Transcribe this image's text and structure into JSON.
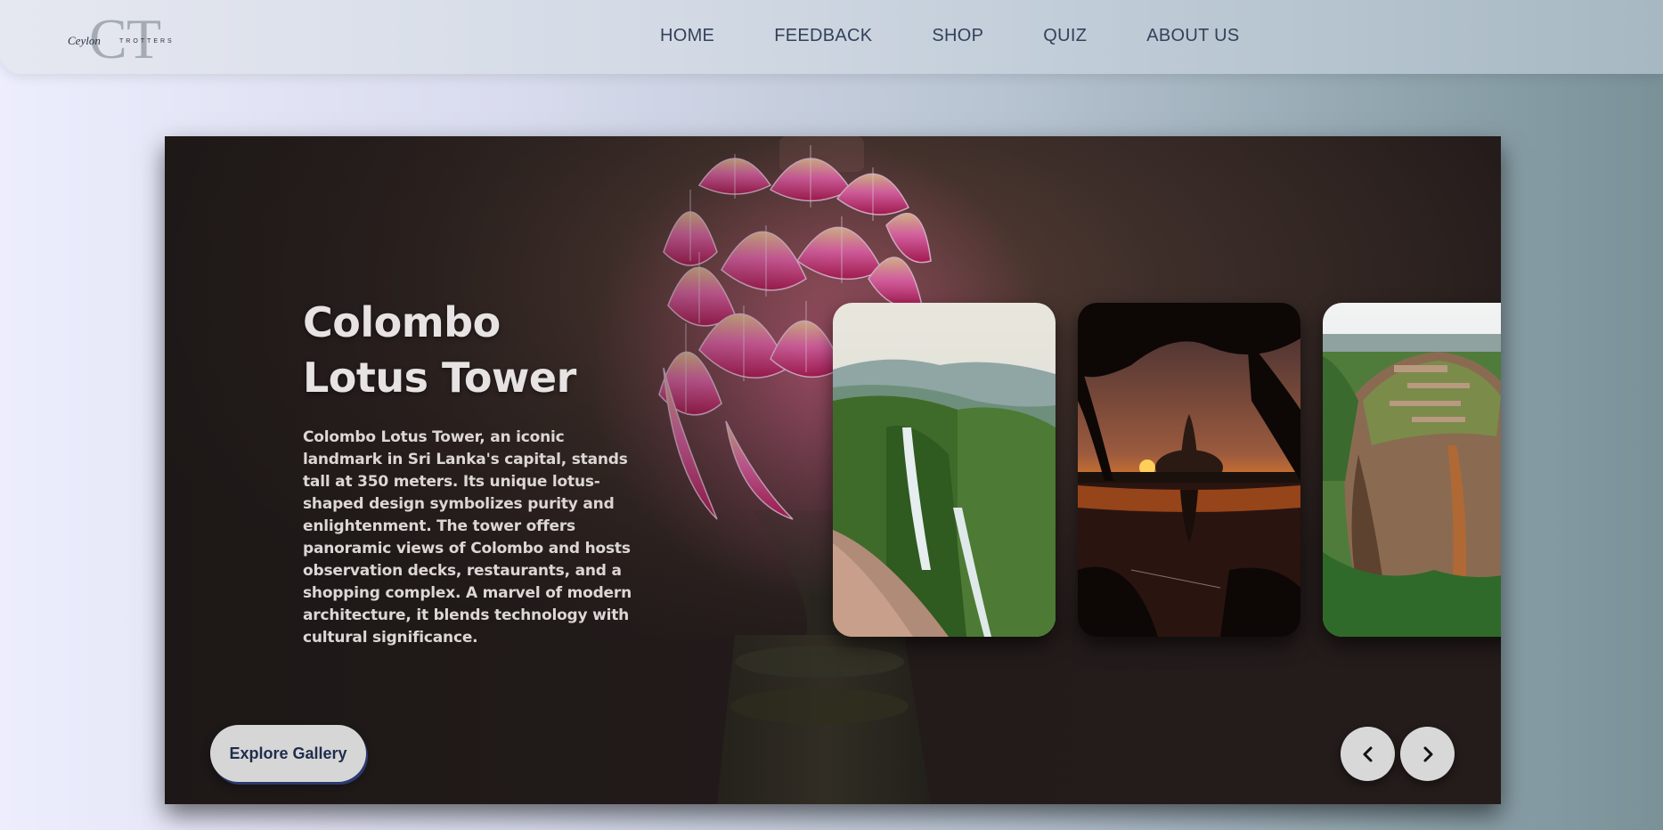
{
  "brand": {
    "logo_letters": "CT",
    "logo_script": "Ceylon",
    "logo_caps": "TROTTERS"
  },
  "nav": {
    "items": [
      {
        "label": "HOME"
      },
      {
        "label": "FEEDBACK"
      },
      {
        "label": "SHOP"
      },
      {
        "label": "QUIZ"
      },
      {
        "label": "ABOUT US"
      }
    ]
  },
  "hero": {
    "title": "Colombo Lotus Tower",
    "description": "Colombo Lotus Tower, an iconic landmark in Sri Lanka's capital, stands tall at 350 meters. Its unique lotus-shaped design symbolizes purity and enlightenment. The tower offers panoramic views of Colombo and hosts observation decks, restaurants, and a shopping complex. A marvel of modern architecture, it blends technology with cultural significance.",
    "explore_label": "Explore Gallery",
    "cards": [
      {
        "icon": "waterfall-image"
      },
      {
        "icon": "stupa-sunset-image"
      },
      {
        "icon": "sigiriya-rock-image"
      }
    ],
    "prev_icon": "chevron-left-icon",
    "next_icon": "chevron-right-icon"
  },
  "colors": {
    "nav_text": "#33415a",
    "button_bg": "#d6d6d6",
    "button_text": "#1f2d4d",
    "lotus_pink": "#ff4fb0"
  }
}
